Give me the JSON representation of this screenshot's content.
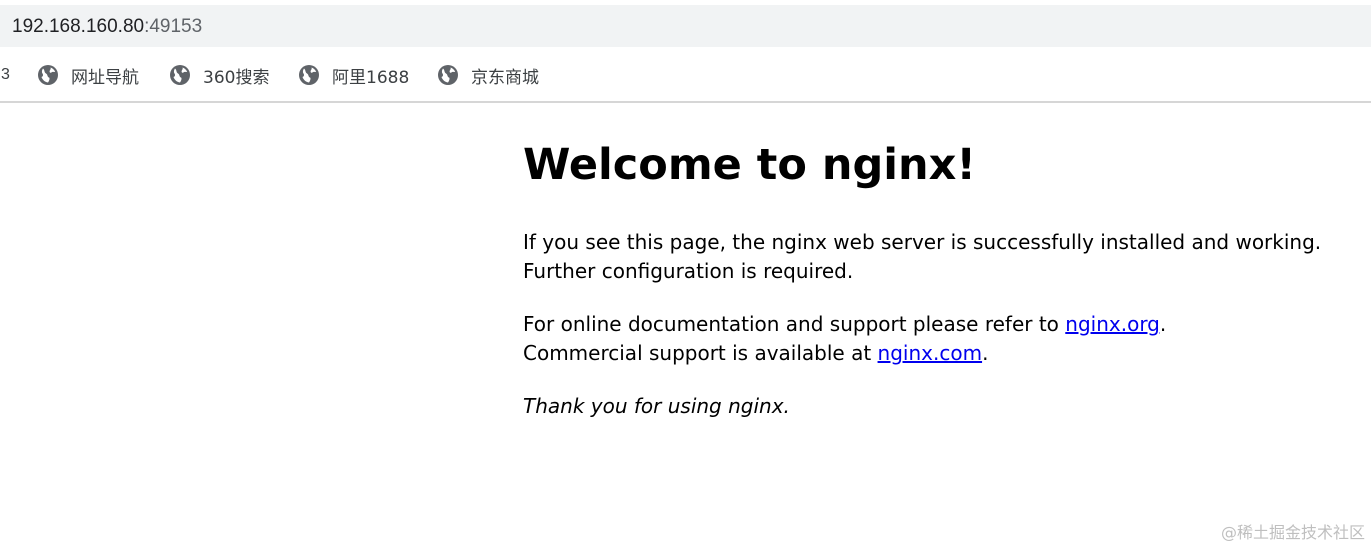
{
  "address_bar": {
    "host": "192.168.160.80",
    "port": ":49153"
  },
  "bookmarks": {
    "cut_off_label": "3",
    "items": [
      {
        "label": "网址导航",
        "icon": "globe-icon"
      },
      {
        "label": "360搜索",
        "icon": "globe-icon"
      },
      {
        "label": "阿里1688",
        "icon": "globe-icon"
      },
      {
        "label": "京东商城",
        "icon": "globe-icon"
      }
    ]
  },
  "page": {
    "heading": "Welcome to nginx!",
    "para1": "If you see this page, the nginx web server is successfully installed and working. Further configuration is required.",
    "para2_text1": "For online documentation and support please refer to ",
    "para2_link1": "nginx.org",
    "para2_text2": ".",
    "para2_text3": "Commercial support is available at ",
    "para2_link2": "nginx.com",
    "para2_text4": ".",
    "thanks": "Thank you for using nginx."
  },
  "watermark": "@稀土掘金技术社区",
  "colors": {
    "link": "#0000ee",
    "address_bar_bg": "#f1f3f4",
    "bookmark_icon": "#5f6368"
  }
}
